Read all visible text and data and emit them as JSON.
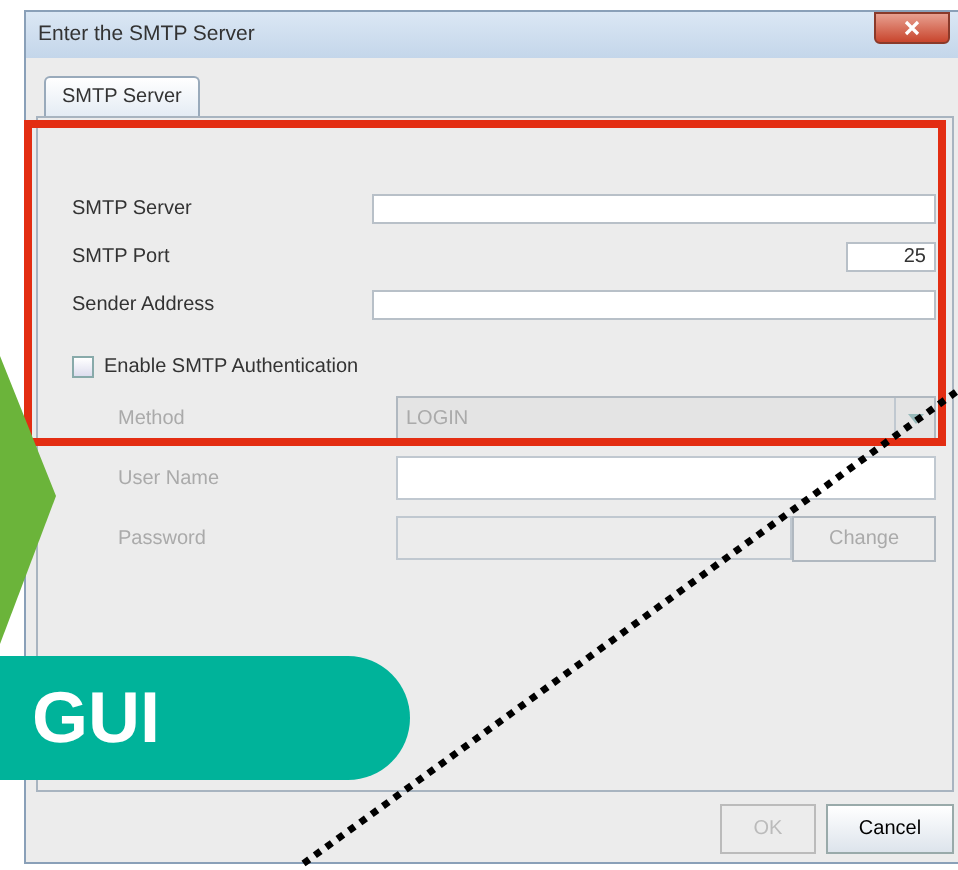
{
  "window": {
    "title": "Enter the SMTP Server"
  },
  "tabs": [
    {
      "label": "SMTP Server",
      "selected": true
    }
  ],
  "fields": [
    {
      "kind": "text",
      "label": "SMTP Server"
    },
    {
      "kind": "port",
      "label": "SMTP Port",
      "value": "25"
    },
    {
      "kind": "text",
      "label": "Sender Address"
    }
  ],
  "auth_checkbox": {
    "label": "Enable SMTP Authentication",
    "checked": false
  },
  "auth_fields": [
    {
      "kind": "combo",
      "label": "Method",
      "value": "LOGIN",
      "disabled": true
    },
    {
      "kind": "text",
      "label": "User Name",
      "disabled": true
    },
    {
      "kind": "password",
      "label": "Password",
      "disabled": true,
      "button": "Change"
    }
  ],
  "buttons": [
    {
      "label": "OK",
      "disabled": true
    },
    {
      "label": "Cancel",
      "disabled": false
    }
  ],
  "callout": {
    "label": "GUI"
  }
}
